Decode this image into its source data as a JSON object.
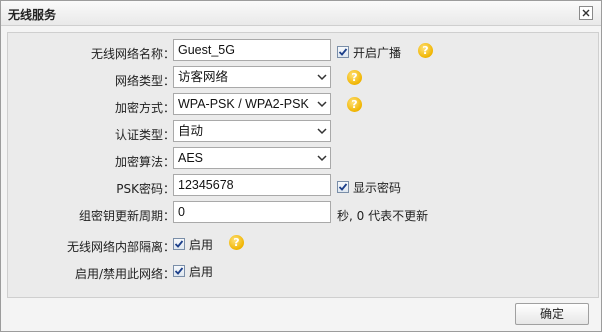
{
  "dialog": {
    "title": "无线服务",
    "ok_label": "确定"
  },
  "form": {
    "ssid": {
      "label": "无线网络名称：",
      "value": "Guest_5G",
      "broadcast_label": "开启广播",
      "broadcast_checked": true
    },
    "network_type": {
      "label": "网络类型：",
      "value": "访客网络"
    },
    "encryption": {
      "label": "加密方式：",
      "value": "WPA-PSK / WPA2-PSK"
    },
    "auth_type": {
      "label": "认证类型：",
      "value": "自动"
    },
    "cipher": {
      "label": "加密算法：",
      "value": "AES"
    },
    "psk": {
      "label": "PSK密码：",
      "value": "12345678",
      "show_label": "显示密码",
      "show_checked": true
    },
    "group_key": {
      "label": "组密钥更新周期：",
      "value": "0",
      "note": "秒, 0 代表不更新"
    },
    "isolation": {
      "label": "无线网络内部隔离：",
      "check_label": "启用",
      "checked": true
    },
    "enable": {
      "label": "启用/禁用此网络：",
      "check_label": "启用",
      "checked": true
    }
  },
  "icons": {
    "help": "help-question-icon",
    "close": "close-icon",
    "dropdown": "chevron-down-icon",
    "check": "checkmark-icon"
  },
  "colors": {
    "help_icon": "#f0b400",
    "panel_bg": "#ebebeb",
    "checkbox_border": "#7a8ea8"
  }
}
